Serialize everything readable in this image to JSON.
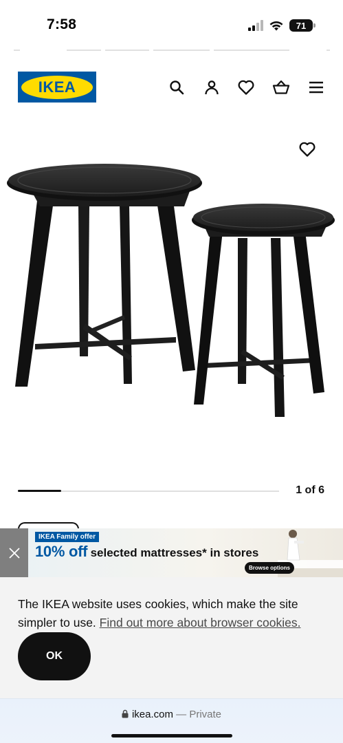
{
  "status_bar": {
    "time": "7:58",
    "battery": "71",
    "icons": [
      "cellular-signal-icon",
      "wifi-icon",
      "battery-icon"
    ]
  },
  "header": {
    "logo_text": "IKEA",
    "icons": [
      "search-icon",
      "account-icon",
      "heart-icon",
      "basket-icon",
      "menu-icon"
    ],
    "colors": {
      "logo_blue": "#0058a3",
      "logo_yellow": "#ffdb00"
    }
  },
  "product": {
    "favourite_icon": "heart-icon",
    "image": "two-black-nesting-tables"
  },
  "carousel": {
    "counter": "1 of 6",
    "position": 1,
    "total": 6
  },
  "promo": {
    "badge": "IKEA Family offer",
    "percent": "10% off",
    "rest": "selected mattresses* in stores",
    "cta": "Browse options",
    "close_icon": "close-icon",
    "colors": {
      "accent": "#0058a3"
    }
  },
  "cookie": {
    "text": "The IKEA website uses cookies, which make the site simpler to use.",
    "link": "Find out more about browser cookies.",
    "ok": "OK"
  },
  "browser": {
    "url": "ikea.com",
    "separator": "—",
    "mode": "Private",
    "lock_icon": "lock-icon"
  }
}
